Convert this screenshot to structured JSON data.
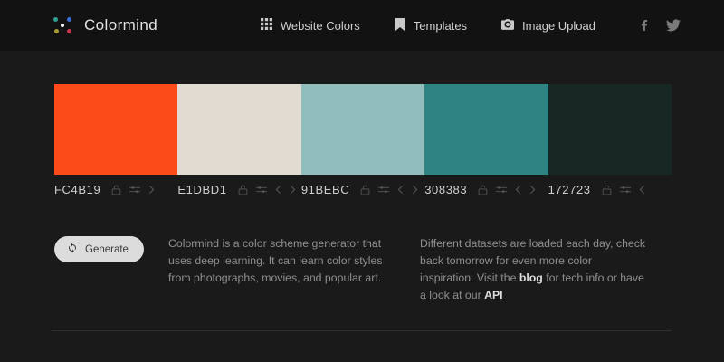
{
  "header": {
    "brand": "Colormind",
    "nav": [
      {
        "label": "Website Colors",
        "icon": "grid-icon"
      },
      {
        "label": "Templates",
        "icon": "bookmark-icon"
      },
      {
        "label": "Image Upload",
        "icon": "camera-icon"
      }
    ],
    "social": [
      {
        "icon": "facebook-icon"
      },
      {
        "icon": "twitter-icon"
      }
    ],
    "logo_colors": {
      "top_left": "#2fa08f",
      "top_right": "#3d6dd0",
      "center": "#f5f5f5",
      "bottom_left": "#a89b35",
      "bottom_right": "#c4374b"
    }
  },
  "palette": {
    "swatches": [
      {
        "hex": "FC4B19",
        "color": "#FC4B19",
        "icons": [
          "lock-icon",
          "sliders-icon",
          "chevron-right-icon"
        ]
      },
      {
        "hex": "E1DBD1",
        "color": "#E1DBD1",
        "icons": [
          "lock-icon",
          "sliders-icon",
          "chevron-left-icon",
          "chevron-right-icon"
        ]
      },
      {
        "hex": "91BEBC",
        "color": "#91BEBC",
        "icons": [
          "lock-icon",
          "sliders-icon",
          "chevron-left-icon",
          "chevron-right-icon"
        ]
      },
      {
        "hex": "308383",
        "color": "#308383",
        "icons": [
          "lock-icon",
          "sliders-icon",
          "chevron-left-icon",
          "chevron-right-icon"
        ]
      },
      {
        "hex": "172723",
        "color": "#172723",
        "icons": [
          "lock-icon",
          "sliders-icon",
          "chevron-left-icon"
        ]
      }
    ]
  },
  "controls": {
    "generate_label": "Generate",
    "generate_icon": "refresh-icon"
  },
  "about": {
    "description": "Colormind is a color scheme generator that uses deep learning. It can learn color styles from photographs, movies, and popular art.",
    "datasets_text_1": "Different datasets are loaded each day, check back tomorrow for even more color inspiration. Visit the ",
    "blog_link": "blog",
    "datasets_text_2": " for tech info or have a look at our ",
    "api_link": "API"
  },
  "theme": {
    "header_bg": "#121212",
    "body_bg": "#1a1a1a",
    "divider": "#2e2e2e",
    "button_bg": "#dcdcdc"
  }
}
